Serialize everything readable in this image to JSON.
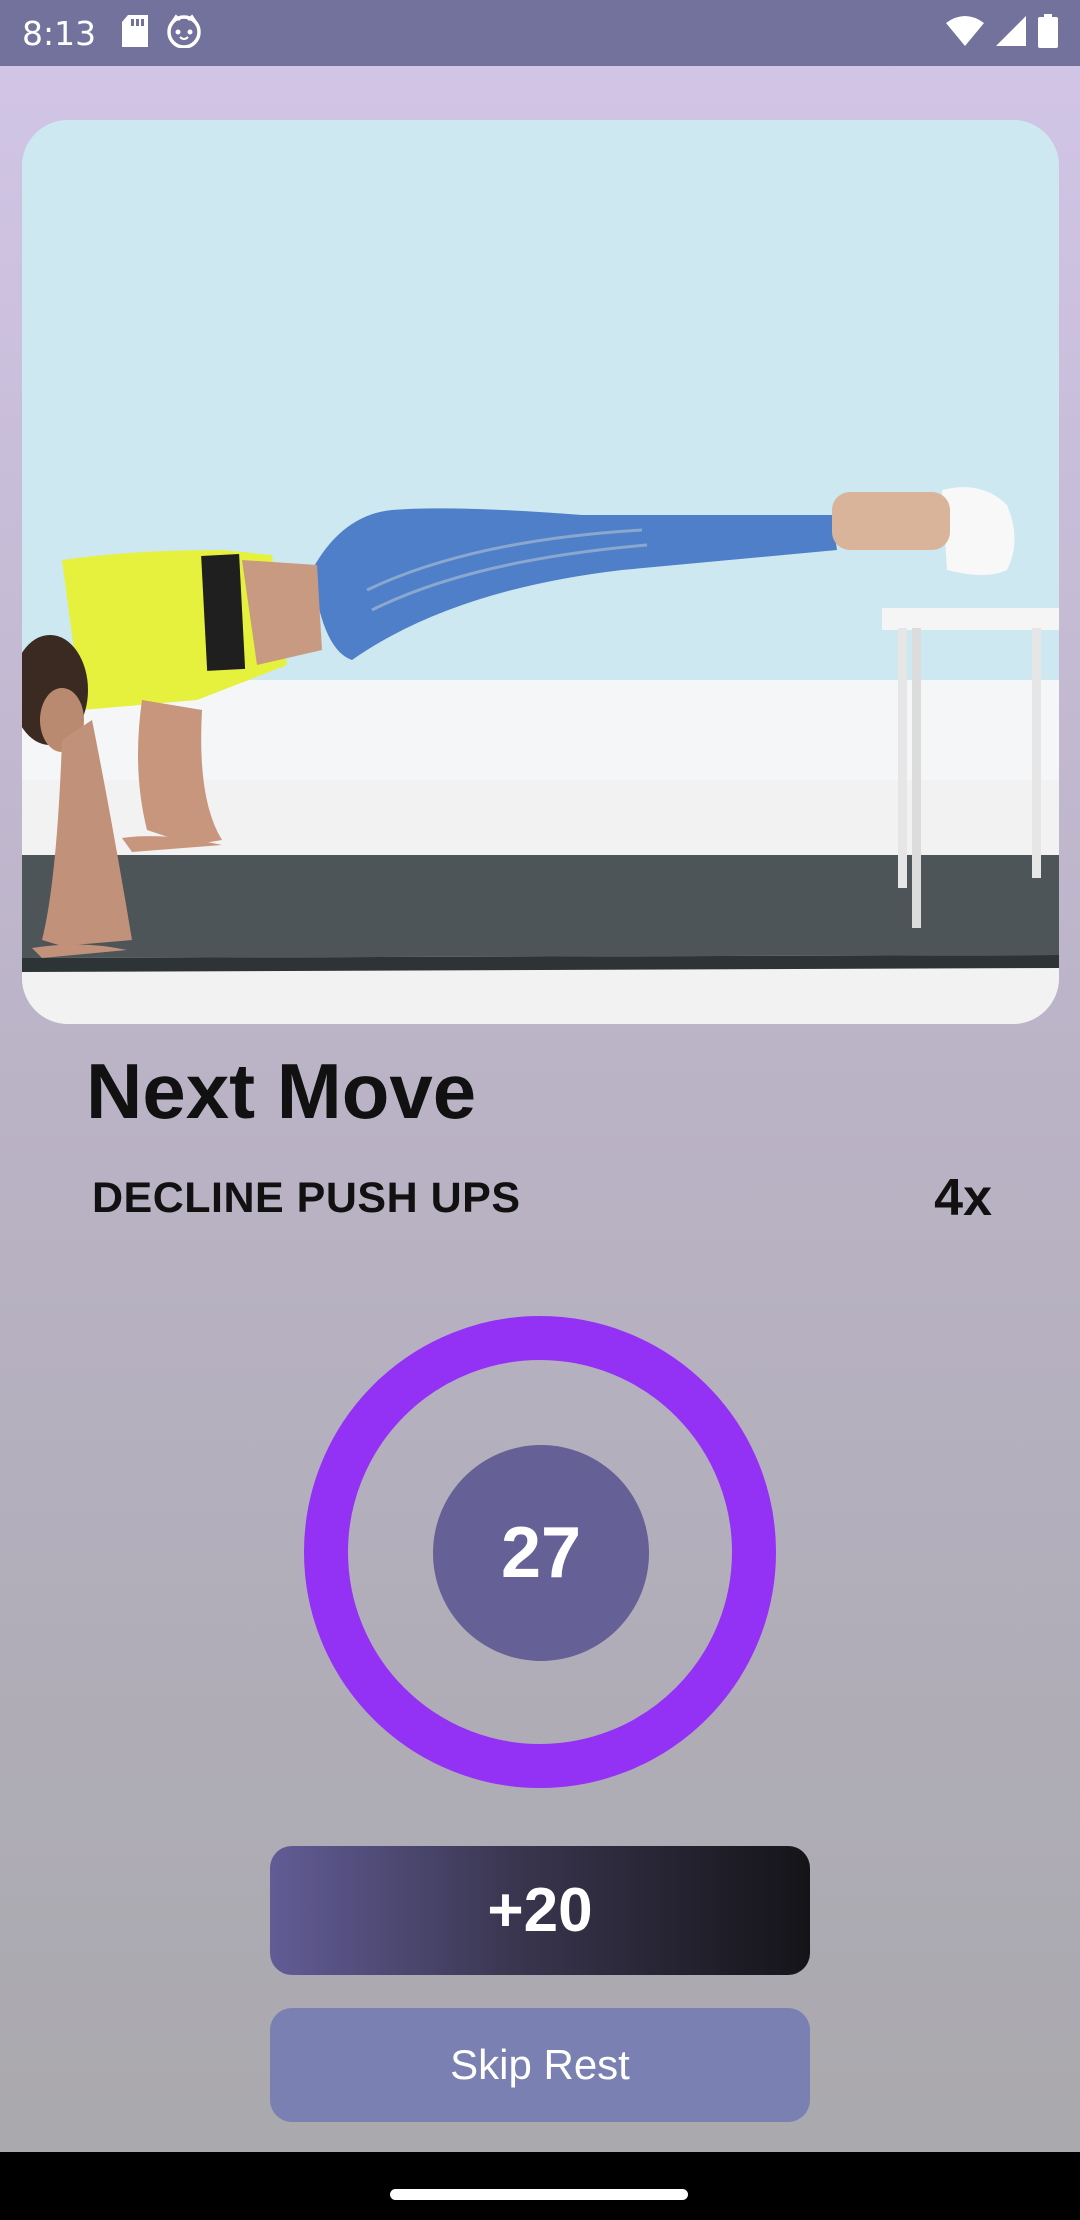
{
  "status_bar": {
    "time": "8:13",
    "left_icons": [
      "sd-card-icon",
      "cat-face-icon"
    ],
    "right_icons": [
      "wifi-icon",
      "signal-icon",
      "battery-icon"
    ]
  },
  "media": {
    "description_icon": "exercise-image"
  },
  "next_move": {
    "title": "Next Move",
    "exercise_name": "DECLINE PUSH UPS",
    "reps": "4x"
  },
  "timer": {
    "seconds": "27",
    "ring_color": "#9331f5",
    "center_color": "#656095"
  },
  "buttons": {
    "add_time_label": "+20",
    "skip_label": "Skip Rest"
  },
  "colors": {
    "status_bar": "#72729c",
    "skip_button": "#7a81b2"
  }
}
